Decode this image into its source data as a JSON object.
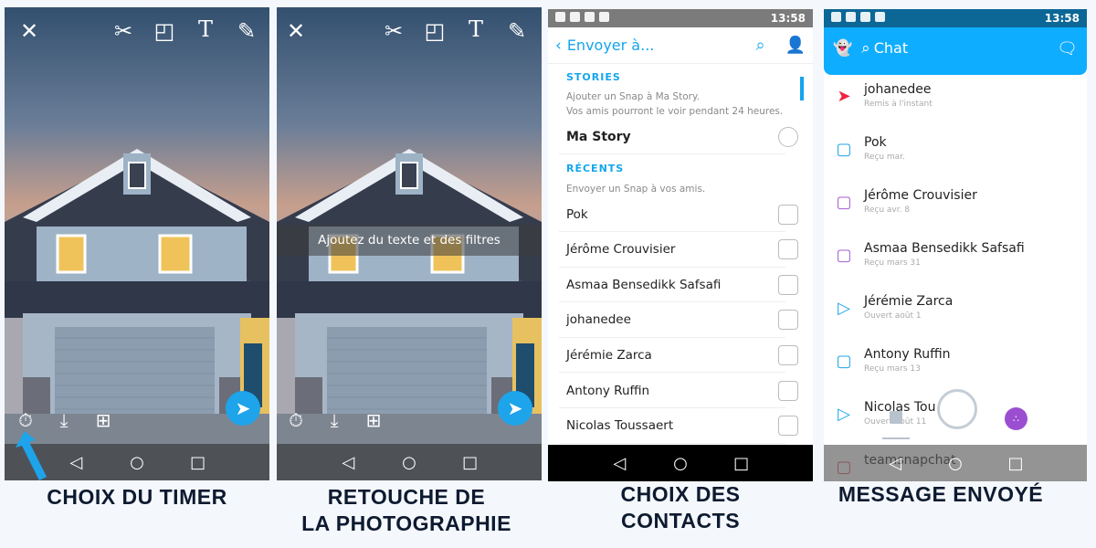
{
  "panels": {
    "timer": {
      "caption": "CHOIX DU TIMER",
      "top_icons": [
        "close-icon",
        "scissors-icon",
        "sticker-icon",
        "text-icon",
        "pencil-icon"
      ],
      "timer_value": "3"
    },
    "edit": {
      "caption_line1": "RETOUCHE DE",
      "caption_line2": "LA PHOTOGRAPHIE",
      "banner": "Ajoutez du texte et des filtres",
      "timer_value": "3"
    },
    "contacts": {
      "caption_line1": "CHOIX DES",
      "caption_line2": "CONTACTS",
      "status_time": "13:58",
      "header_title": "Envoyer à...",
      "stories_heading": "STORIES",
      "stories_hint1": "Ajouter un Snap à Ma Story.",
      "stories_hint2": "Vos amis pourront le voir pendant 24 heures.",
      "my_story": "Ma Story",
      "recents_heading": "RÉCENTS",
      "recents_hint": "Envoyer un Snap à vos amis.",
      "contacts": [
        "Pok",
        "Jérôme Crouvisier",
        "Asmaa Bensedikk Safsafi",
        "johanedee",
        "Jérémie Zarca",
        "Antony Ruffin",
        "Nicolas Toussaert"
      ]
    },
    "chat": {
      "caption": "MESSAGE ENVOYÉ",
      "status_time": "13:58",
      "header_title": "Chat",
      "accent": "#0fadff",
      "conversations": [
        {
          "name": "johanedee",
          "status": "Remis à l'instant",
          "icon": "sent-filled-icon",
          "color": "#f0233e"
        },
        {
          "name": "Pok",
          "status": "Reçu mar.",
          "icon": "chat-bubble-icon",
          "color": "#1ea4ea"
        },
        {
          "name": "Jérôme Crouvisier",
          "status": "Reçu avr. 8",
          "icon": "received-snap-icon",
          "color": "#a55fd3"
        },
        {
          "name": "Asmaa Bensedikk Safsafi",
          "status": "Reçu mars 31",
          "icon": "received-snap-icon",
          "color": "#a55fd3"
        },
        {
          "name": "Jérémie Zarca",
          "status": "Ouvert août 1",
          "icon": "opened-arrow-icon",
          "color": "#1ea4ea"
        },
        {
          "name": "Antony Ruffin",
          "status": "Reçu mars 13",
          "icon": "chat-bubble-icon",
          "color": "#1ea4ea"
        },
        {
          "name": "Nicolas Tou",
          "status": "Ouvert août 11",
          "icon": "opened-arrow-icon",
          "color": "#1ea4ea"
        },
        {
          "name": "teamsnapchat",
          "status": "",
          "icon": "received-snap-icon",
          "color": "#e05060"
        }
      ]
    }
  }
}
